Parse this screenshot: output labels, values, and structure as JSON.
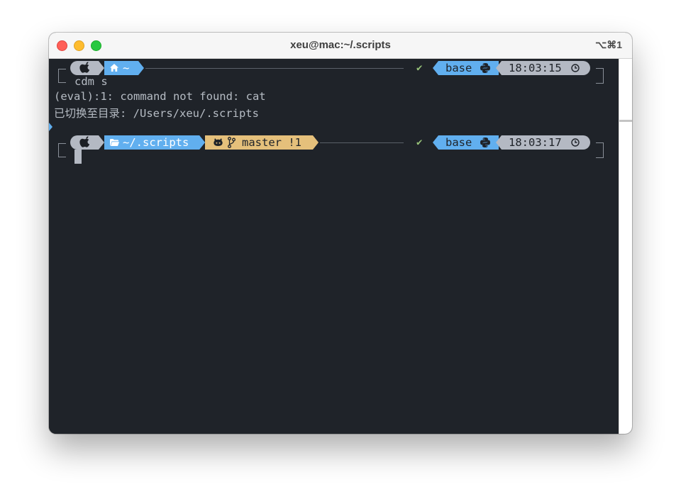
{
  "window": {
    "title": "xeu@mac:~/.scripts",
    "shortcut": "⌥⌘1"
  },
  "prompt1": {
    "dir_label": "~",
    "env": "base",
    "time": "18:03:15"
  },
  "output": [
    "cdm s",
    "(eval):1: command not found: cat",
    "已切换至目录: /Users/xeu/.scripts"
  ],
  "prompt2": {
    "dir_label": "~/.scripts",
    "git_branch": "master !1",
    "env": "base",
    "time": "18:03:17"
  },
  "icons": {
    "os": "apple-icon",
    "home": "home-icon",
    "folder": "folder-icon",
    "github": "github-icon",
    "branch": "git-branch-icon",
    "python": "python-icon",
    "clock": "clock-icon",
    "status_ok": "check-icon"
  },
  "colors": {
    "terminal_bg": "#1f2329",
    "segment_gray": "#b4b9c3",
    "segment_blue": "#61afef",
    "segment_yellow": "#e5c07b",
    "ok_green": "#98c379"
  }
}
